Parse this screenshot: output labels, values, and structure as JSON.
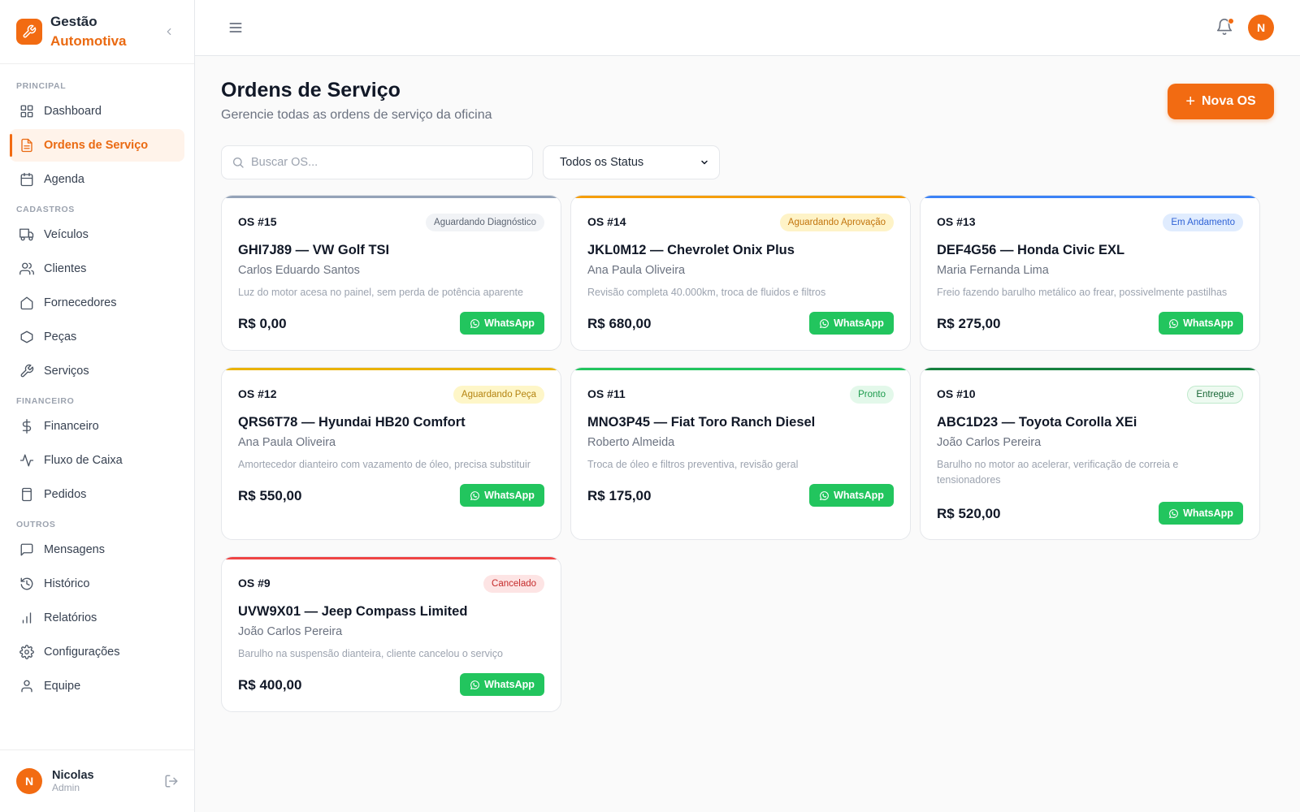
{
  "brand": {
    "line1": "Gestão",
    "line2": "Automotiva"
  },
  "sidebar": {
    "sections": [
      {
        "label": "PRINCIPAL",
        "items": [
          {
            "label": "Dashboard",
            "icon": "grid-icon"
          },
          {
            "label": "Ordens de Serviço",
            "icon": "document-icon",
            "active": true
          },
          {
            "label": "Agenda",
            "icon": "calendar-icon"
          }
        ]
      },
      {
        "label": "CADASTROS",
        "items": [
          {
            "label": "Veículos",
            "icon": "truck-icon"
          },
          {
            "label": "Clientes",
            "icon": "users-icon"
          },
          {
            "label": "Fornecedores",
            "icon": "home-icon"
          },
          {
            "label": "Peças",
            "icon": "hexagon-icon"
          },
          {
            "label": "Serviços",
            "icon": "wrench-icon"
          }
        ]
      },
      {
        "label": "FINANCEIRO",
        "items": [
          {
            "label": "Financeiro",
            "icon": "dollar-icon"
          },
          {
            "label": "Fluxo de Caixa",
            "icon": "activity-icon"
          },
          {
            "label": "Pedidos",
            "icon": "clipboard-icon"
          }
        ]
      },
      {
        "label": "OUTROS",
        "items": [
          {
            "label": "Mensagens",
            "icon": "message-icon"
          },
          {
            "label": "Histórico",
            "icon": "history-icon"
          },
          {
            "label": "Relatórios",
            "icon": "bar-chart-icon"
          },
          {
            "label": "Configurações",
            "icon": "gear-icon"
          },
          {
            "label": "Equipe",
            "icon": "team-icon"
          }
        ]
      }
    ]
  },
  "user": {
    "initial": "N",
    "name": "Nicolas",
    "role": "Admin"
  },
  "topbar": {
    "avatar_initial": "N"
  },
  "page": {
    "title": "Ordens de Serviço",
    "subtitle": "Gerencie todas as ordens de serviço da oficina",
    "new_button": "Nova OS",
    "new_button_icon": "+",
    "search_placeholder": "Buscar OS...",
    "status_filter": "Todos os Status"
  },
  "colors": {
    "accent": "#f26b12",
    "whatsapp": "#22c55e"
  },
  "orders": [
    {
      "os": "OS #15",
      "status": "Aguardando Diagnóstico",
      "status_bg": "#f1f3f6",
      "status_fg": "#5b6472",
      "line": "#94a3b8",
      "title": "GHI7J89 — VW Golf TSI",
      "client": "Carlos Eduardo Santos",
      "desc": "Luz do motor acesa no painel, sem perda de potência aparente",
      "price": "R$ 0,00",
      "action": "WhatsApp"
    },
    {
      "os": "OS #14",
      "status": "Aguardando Aprovação",
      "status_bg": "#fef3c7",
      "status_fg": "#c2740c",
      "line": "#f59e0b",
      "title": "JKL0M12 — Chevrolet Onix Plus",
      "client": "Ana Paula Oliveira",
      "desc": "Revisão completa 40.000km, troca de fluidos e filtros",
      "price": "R$ 680,00",
      "action": "WhatsApp"
    },
    {
      "os": "OS #13",
      "status": "Em Andamento",
      "status_bg": "#e0ecfe",
      "status_fg": "#2f62d6",
      "line": "#3b82f6",
      "title": "DEF4G56 — Honda Civic EXL",
      "client": "Maria Fernanda Lima",
      "desc": "Freio fazendo barulho metálico ao frear, possivelmente pastilhas",
      "price": "R$ 275,00",
      "action": "WhatsApp"
    },
    {
      "os": "OS #12",
      "status": "Aguardando Peça",
      "status_bg": "#fef6c8",
      "status_fg": "#b48310",
      "line": "#eab308",
      "title": "QRS6T78 — Hyundai HB20 Comfort",
      "client": "Ana Paula Oliveira",
      "desc": "Amortecedor dianteiro com vazamento de óleo, precisa substituir",
      "price": "R$ 550,00",
      "action": "WhatsApp"
    },
    {
      "os": "OS #11",
      "status": "Pronto",
      "status_bg": "#e3f8ea",
      "status_fg": "#1c9a4c",
      "line": "#22c55e",
      "title": "MNO3P45 — Fiat Toro Ranch Diesel",
      "client": "Roberto Almeida",
      "desc": "Troca de óleo e filtros preventiva, revisão geral",
      "price": "R$ 175,00",
      "action": "WhatsApp"
    },
    {
      "os": "OS #10",
      "status": "Entregue",
      "status_bg": "#eefaf1",
      "status_fg": "#166534",
      "line": "#15803d",
      "title": "ABC1D23 — Toyota Corolla XEi",
      "client": "João Carlos Pereira",
      "desc": "Barulho no motor ao acelerar, verificação de correia e tensionadores",
      "price": "R$ 520,00",
      "action": "WhatsApp"
    },
    {
      "os": "OS #9",
      "status": "Cancelado",
      "status_bg": "#fde4e4",
      "status_fg": "#c52b2b",
      "line": "#ef4444",
      "title": "UVW9X01 — Jeep Compass Limited",
      "client": "João Carlos Pereira",
      "desc": "Barulho na suspensão dianteira, cliente cancelou o serviço",
      "price": "R$ 400,00",
      "action": "WhatsApp"
    }
  ]
}
